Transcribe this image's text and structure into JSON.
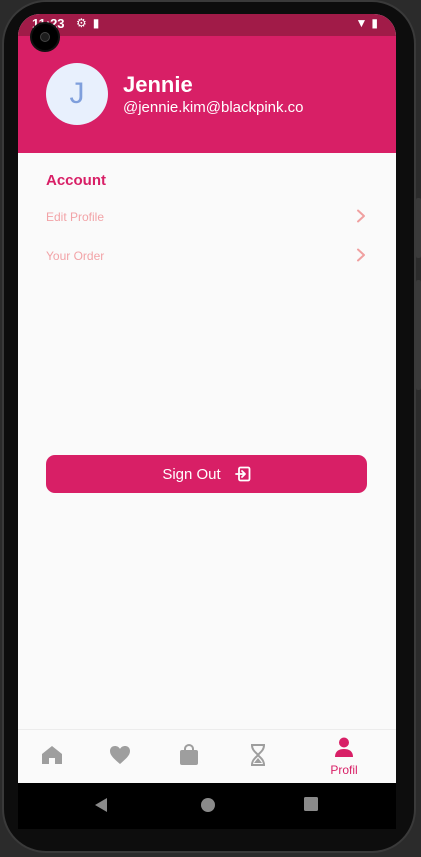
{
  "status_bar": {
    "time": "11:23",
    "left_icons": [
      "settings-icon",
      "sd-card-icon"
    ],
    "right_icons": [
      "wifi-icon",
      "battery-icon"
    ]
  },
  "profile": {
    "avatar_initial": "J",
    "name": "Jennie",
    "email": "@jennie.kim@blackpink.co"
  },
  "account": {
    "title": "Account",
    "items": [
      {
        "label": "Edit Profile",
        "icon": "chevron-right-icon"
      },
      {
        "label": "Your Order",
        "icon": "chevron-right-icon"
      }
    ]
  },
  "sign_out": {
    "label": "Sign Out",
    "icon": "logout-icon"
  },
  "bottom_nav": {
    "items": [
      {
        "icon": "home-icon",
        "label": ""
      },
      {
        "icon": "heart-icon",
        "label": ""
      },
      {
        "icon": "shopping-bag-icon",
        "label": ""
      },
      {
        "icon": "hourglass-icon",
        "label": ""
      },
      {
        "icon": "person-icon",
        "label": "Profil",
        "active": true
      }
    ]
  },
  "colors": {
    "primary": "#d81f66",
    "status_bar": "#a11b48",
    "inactive_icon": "#9e9e9e",
    "menu_text": "#f2a3a7",
    "avatar_bg": "#e8f0fd"
  }
}
